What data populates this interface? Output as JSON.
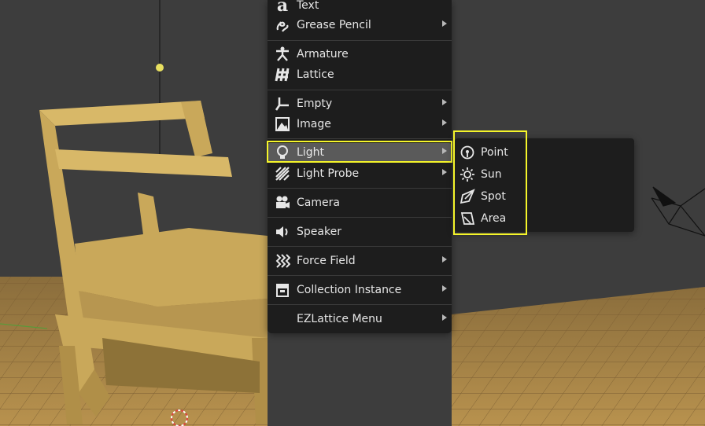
{
  "add_menu": {
    "items": [
      {
        "label": "Text",
        "icon": "text-icon",
        "submenu": false
      },
      {
        "label": "Grease Pencil",
        "icon": "grease-pencil-icon",
        "submenu": true
      },
      {
        "label": "Armature",
        "icon": "armature-icon",
        "submenu": false
      },
      {
        "label": "Lattice",
        "icon": "lattice-icon",
        "submenu": false
      },
      {
        "label": "Empty",
        "icon": "empty-icon",
        "submenu": true
      },
      {
        "label": "Image",
        "icon": "image-icon",
        "submenu": true
      },
      {
        "label": "Light",
        "icon": "light-bulb-icon",
        "submenu": true,
        "highlighted": true
      },
      {
        "label": "Light Probe",
        "icon": "light-probe-icon",
        "submenu": true
      },
      {
        "label": "Camera",
        "icon": "camera-icon",
        "submenu": false
      },
      {
        "label": "Speaker",
        "icon": "speaker-icon",
        "submenu": false
      },
      {
        "label": "Force Field",
        "icon": "force-field-icon",
        "submenu": true
      },
      {
        "label": "Collection Instance",
        "icon": "collection-instance-icon",
        "submenu": true
      },
      {
        "label": "EZLattice Menu",
        "icon": "",
        "submenu": true
      }
    ]
  },
  "light_submenu": {
    "items": [
      {
        "label": "Point",
        "icon": "point-light-icon"
      },
      {
        "label": "Sun",
        "icon": "sun-light-icon"
      },
      {
        "label": "Spot",
        "icon": "spot-light-icon"
      },
      {
        "label": "Area",
        "icon": "area-light-icon"
      }
    ]
  },
  "colors": {
    "menu_bg": "#1d1d1d",
    "highlight_bg": "#5a5a5a",
    "annotation": "#f5f52a",
    "text": "#e6e6e6",
    "chair": "#c9a85a",
    "floor": "#b8924e"
  }
}
